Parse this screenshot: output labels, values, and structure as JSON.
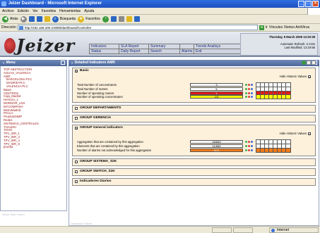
{
  "window": {
    "title": "Jeizer Dashboard - Microsoft Internet Explorer"
  },
  "menubar": [
    "Archivo",
    "Edición",
    "Ver",
    "Favoritos",
    "Herramientas",
    "Ayuda"
  ],
  "toolbar": {
    "back": "Atrás",
    "search": "Búsqueda",
    "favorites": "Favoritos"
  },
  "address": {
    "label": "Dirección",
    "url": "http://192.168.200.3:8080/dashboard/Controller",
    "go": "Ir",
    "links": "Vínculos",
    "extra": "Norton AntiVirus"
  },
  "app": {
    "brand": "Jeizer",
    "nav": [
      "Indicators",
      "SLA Report",
      "Summary",
      "",
      "Trends Analisys",
      "Status",
      "Daily Report",
      "Search",
      "Alarms",
      "Exit"
    ],
    "date": "Thursday, 9 March 2006 13:20:28",
    "refresh": "Automatic Refresh: 2 mins",
    "modified": "Last Modified: 13:19:56"
  },
  "sidebar": {
    "title": "Menu",
    "tree": [
      {
        "label": "TOP ABSTRACTION",
        "level": 0
      },
      {
        "label": "AGUAS_VALENCIA",
        "level": 0
      },
      {
        "label": "AMR",
        "level": 0
      },
      {
        "label": "BARCELONA-PLC",
        "level": 1
      },
      {
        "label": "MADRID-PLC",
        "level": 1
      },
      {
        "label": "VALENCIA-PLC",
        "level": 1
      },
      {
        "label": "Bawa",
        "level": 0
      },
      {
        "label": "CENTROS",
        "level": 0
      },
      {
        "label": "Caja_Madrid",
        "level": 0
      },
      {
        "label": "Hermizo_1",
        "level": 0
      },
      {
        "label": "MORDOR_LNX",
        "level": 0
      },
      {
        "label": "MYCOMPANY",
        "level": 0
      },
      {
        "label": "MetroMadrid",
        "level": 0
      },
      {
        "label": "PAULA",
        "level": 0
      },
      {
        "label": "PruebaSNMP",
        "level": 0
      },
      {
        "label": "Redes",
        "level": 0
      },
      {
        "label": "SISTEMAS_CENTRALES",
        "level": 0
      },
      {
        "label": "THALEKI",
        "level": 0
      },
      {
        "label": "TOHO",
        "level": 0
      },
      {
        "label": "TPV_IDR_1",
        "level": 0
      },
      {
        "label": "TPV_IDR_3",
        "level": 0
      },
      {
        "label": "TPV_IDR_4",
        "level": 0
      },
      {
        "label": "TPV_IDR_5",
        "level": 0
      },
      {
        "label": "prueba",
        "level": 0
      }
    ],
    "footer": "Jeizer Main menu"
  },
  "main": {
    "title": "Detailed Indicators AMR",
    "hide_historic": "Hide Historic Values",
    "groups": [
      {
        "name": "Basic",
        "checked": true,
        "rows": [
          {
            "label": "Total Number of concentrators",
            "value": "3",
            "color": "white",
            "hist": [
              "w",
              "w",
              "w",
              "w",
              "w",
              "w",
              "w",
              "w"
            ]
          },
          {
            "label": "Total Number of meters",
            "value": "5",
            "color": "white",
            "hist": [
              "w",
              "w",
              "w",
              "w",
              "w",
              "w",
              "w",
              "w"
            ]
          },
          {
            "label": "Number of operating meters",
            "value": "1",
            "color": "red",
            "hist": [
              "r",
              "r",
              "r",
              "r",
              "r",
              "r",
              "r",
              "r"
            ]
          },
          {
            "label": "Number of operating concentrators",
            "value": "2/3",
            "color": "yellow",
            "hist": [
              "y",
              "y",
              "y",
              "y",
              "y",
              "y",
              "y",
              "y"
            ]
          }
        ]
      },
      {
        "name": "GROUP DEPARTAMENTO",
        "checked": false,
        "rows": []
      },
      {
        "name": "GROUP GERENCIA",
        "checked": false,
        "rows": []
      },
      {
        "name": "GROUP General indicators",
        "checked": true,
        "rows": [
          {
            "label": "Aggregation that are contained by this aggregation",
            "value": "26/659",
            "color": "white",
            "hist": [
              "w",
              "w",
              "w",
              "w",
              "w",
              "w",
              "w",
              "w"
            ]
          },
          {
            "label": "Elements that are contained by this aggregation",
            "value": "11/659",
            "color": "white",
            "hist": [
              "w",
              "w",
              "w",
              "w",
              "w",
              "w",
              "w",
              "w"
            ]
          },
          {
            "label": "Number of alarms not acknowledged for this aggregation",
            "value": "9/11",
            "color": "orange",
            "hist": [
              "o",
              "o",
              "o",
              "o",
              "o",
              "o",
              "o",
              "o"
            ]
          }
        ]
      },
      {
        "name": "GROUP SISTEMA_S2K",
        "checked": false,
        "rows": []
      },
      {
        "name": "GROUP SWITCH_S2K",
        "checked": false,
        "rows": []
      },
      {
        "name": "Indicadores Diarios",
        "checked": false,
        "rows": []
      }
    ],
    "footer": "Indicators Panel"
  },
  "status": {
    "zone": "Internet"
  }
}
